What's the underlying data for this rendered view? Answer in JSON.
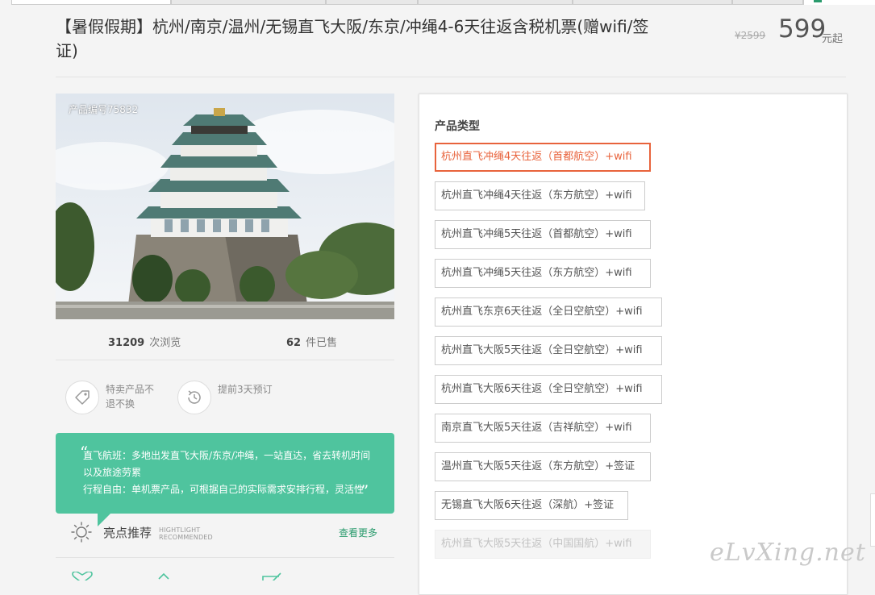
{
  "product": {
    "title": "【暑假假期】杭州/南京/温州/无锡直飞大阪/东京/冲绳4-6天往返含税机票(赠wifi/签证)",
    "price_old": "¥2599",
    "price": "599",
    "price_unit": "元起",
    "code_label": "产品编号75832"
  },
  "stats": {
    "views_count": "31209",
    "views_label": "次浏览",
    "sold_count": "62",
    "sold_label": "件已售"
  },
  "badges": [
    {
      "icon": "tag-icon",
      "text": "特卖产品不退不换"
    },
    {
      "icon": "clock-icon",
      "text": "提前3天预订"
    }
  ],
  "bubble": {
    "quote_open": "“",
    "quote_close": "”",
    "lines": [
      "直飞航班：多地出发直飞大阪/东京/冲绳，一站直达，省去转机时间以及旅途劳累",
      "行程自由：单机票产品，可根据自己的实际需求安排行程，灵活性"
    ]
  },
  "highlight": {
    "icon": "sun-icon",
    "label": "亮点推荐",
    "en_line1": "HIGHTLIGHT",
    "en_line2": "RECOMMENDED",
    "more": "查看更多"
  },
  "panel": {
    "title": "产品类型",
    "options": [
      {
        "label": "杭州直飞冲绳4天往返（首都航空）+wifi",
        "state": "selected"
      },
      {
        "label": "杭州直飞冲绳4天往返（东方航空）+wifi",
        "state": "normal"
      },
      {
        "label": "杭州直飞冲绳5天往返（首都航空）+wifi",
        "state": "normal"
      },
      {
        "label": "杭州直飞冲绳5天往返（东方航空）+wifi",
        "state": "normal"
      },
      {
        "label": "杭州直飞东京6天往返（全日空航空）+wifi",
        "state": "normal"
      },
      {
        "label": "杭州直飞大阪5天往返（全日空航空）+wifi",
        "state": "normal"
      },
      {
        "label": "杭州直飞大阪6天往返（全日空航空）+wifi",
        "state": "normal"
      },
      {
        "label": "南京直飞大阪5天往返（吉祥航空）+wifi",
        "state": "normal"
      },
      {
        "label": "温州直飞大阪5天往返（东方航空）+签证",
        "state": "normal"
      },
      {
        "label": "无锡直飞大阪6天往返（深航）+签证",
        "state": "normal"
      },
      {
        "label": "杭州直飞大阪5天往返（中国国航）+wifi",
        "state": "disabled"
      }
    ]
  },
  "watermark": "eLvXing.net",
  "colors": {
    "accent_green": "#4fc49e",
    "link_green": "#2a9b6d",
    "selected_orange": "#e8633c"
  }
}
